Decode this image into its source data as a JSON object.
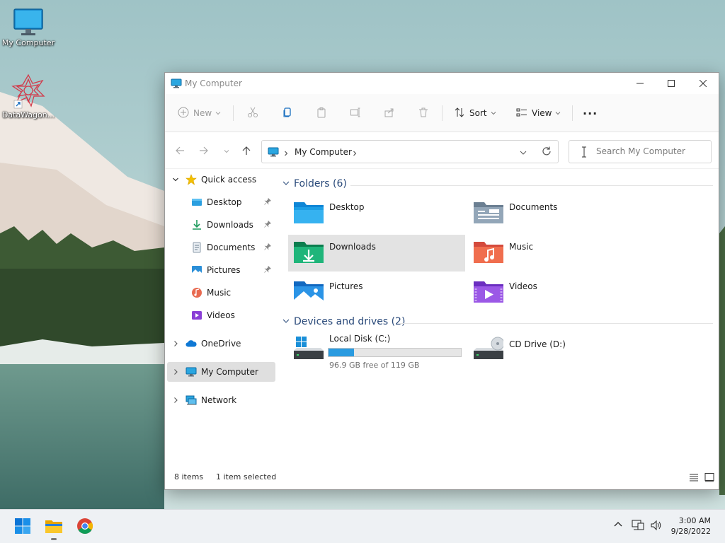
{
  "desktop": {
    "icons": [
      {
        "label": "My Computer",
        "icon": "monitor-icon"
      },
      {
        "label": "DataWagon...",
        "icon": "datawagon-shortcut-icon"
      }
    ]
  },
  "window": {
    "title": "My Computer",
    "toolbar": {
      "new_label": "New",
      "sort_label": "Sort",
      "view_label": "View",
      "more_label": "···"
    },
    "address": {
      "crumbs": [
        "My Computer"
      ]
    },
    "search": {
      "placeholder": "Search My Computer"
    },
    "sidebar": {
      "quick_access": "Quick access",
      "quick_items": [
        {
          "label": "Desktop",
          "pinned": true,
          "icon": "desktop-folder-icon"
        },
        {
          "label": "Downloads",
          "pinned": true,
          "icon": "downloads-icon"
        },
        {
          "label": "Documents",
          "pinned": true,
          "icon": "documents-icon"
        },
        {
          "label": "Pictures",
          "pinned": true,
          "icon": "pictures-icon"
        },
        {
          "label": "Music",
          "pinned": false,
          "icon": "music-icon"
        },
        {
          "label": "Videos",
          "pinned": false,
          "icon": "videos-icon"
        }
      ],
      "onedrive": "OneDrive",
      "my_computer": "My Computer",
      "network": "Network"
    },
    "content": {
      "folders_header": "Folders (6)",
      "folders": [
        {
          "name": "Desktop",
          "icon": "desktop-folder-icon"
        },
        {
          "name": "Documents",
          "icon": "documents-folder-icon"
        },
        {
          "name": "Downloads",
          "icon": "downloads-folder-icon",
          "selected": true
        },
        {
          "name": "Music",
          "icon": "music-folder-icon"
        },
        {
          "name": "Pictures",
          "icon": "pictures-folder-icon"
        },
        {
          "name": "Videos",
          "icon": "videos-folder-icon"
        }
      ],
      "drives_header": "Devices and drives (2)",
      "drives": [
        {
          "name": "Local Disk (C:)",
          "free_text": "96.9 GB free of 119 GB",
          "used_fraction": 0.19,
          "icon": "local-disk-icon"
        },
        {
          "name": "CD Drive (D:)",
          "icon": "cd-drive-icon"
        }
      ]
    },
    "status": {
      "items": "8 items",
      "selected": "1 item selected"
    }
  },
  "taskbar": {
    "apps": [
      "start-icon",
      "file-explorer-icon",
      "chrome-icon"
    ],
    "time": "3:00 AM",
    "date": "9/28/2022"
  },
  "colors": {
    "accent": "#2a9be0",
    "selection": "#e3e3e3",
    "section_header": "#2a4a7a"
  }
}
